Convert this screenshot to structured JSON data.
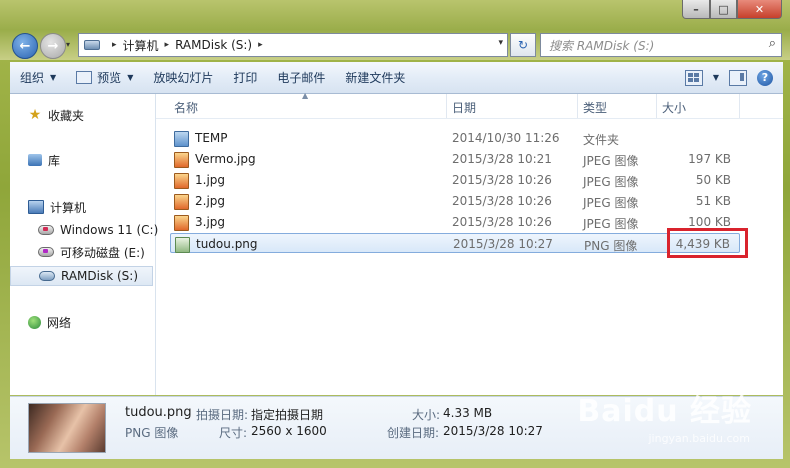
{
  "window": {
    "caption": {
      "minimize": "–",
      "maximize": "□",
      "close": "✕"
    }
  },
  "address_bar": {
    "crumbs": [
      "计算机",
      "RAMDisk (S:)"
    ],
    "search_placeholder": "搜索 RAMDisk (S:)"
  },
  "toolbar": {
    "organize": "组织",
    "preview": "预览",
    "slideshow": "放映幻灯片",
    "print": "打印",
    "email": "电子邮件",
    "new_folder": "新建文件夹",
    "help": "?"
  },
  "nav_pane": {
    "favorites": "收藏夹",
    "libraries": "库",
    "computer": "计算机",
    "drives": [
      "Windows 11 (C:)",
      "可移动磁盘 (E:)",
      "RAMDisk (S:)"
    ],
    "network": "网络"
  },
  "columns": {
    "name": "名称",
    "date": "日期",
    "type": "类型",
    "size": "大小"
  },
  "files": [
    {
      "icon": "folder-icon",
      "name": "TEMP",
      "date": "2014/10/30 11:26",
      "type": "文件夹",
      "size": ""
    },
    {
      "icon": "jpg-file-icon",
      "name": "Vermo.jpg",
      "date": "2015/3/28 10:21",
      "type": "JPEG 图像",
      "size": "197 KB"
    },
    {
      "icon": "jpg-file-icon",
      "name": "1.jpg",
      "date": "2015/3/28 10:26",
      "type": "JPEG 图像",
      "size": "50 KB"
    },
    {
      "icon": "jpg-file-icon",
      "name": "2.jpg",
      "date": "2015/3/28 10:26",
      "type": "JPEG 图像",
      "size": "51 KB"
    },
    {
      "icon": "jpg-file-icon",
      "name": "3.jpg",
      "date": "2015/3/28 10:26",
      "type": "JPEG 图像",
      "size": "100 KB"
    },
    {
      "icon": "png-file-icon",
      "name": "tudou.png",
      "date": "2015/3/28 10:27",
      "type": "PNG 图像",
      "size": "4,439 KB"
    }
  ],
  "details": {
    "filename": "tudou.png",
    "filetype": "PNG 图像",
    "date_taken_label": "拍摄日期:",
    "date_taken_value": "指定拍摄日期",
    "dimensions_label": "尺寸:",
    "dimensions_value": "2560 x 1600",
    "size_label": "大小:",
    "size_value": "4.33 MB",
    "created_label": "创建日期:",
    "created_value": "2015/3/28 10:27"
  },
  "watermark": {
    "main": "Baidu 经验",
    "sub": "jingyan.baidu.com"
  },
  "colors": {
    "highlight": "#d9232d",
    "selection": "#d8e8f9",
    "accent": "#1e395b"
  }
}
